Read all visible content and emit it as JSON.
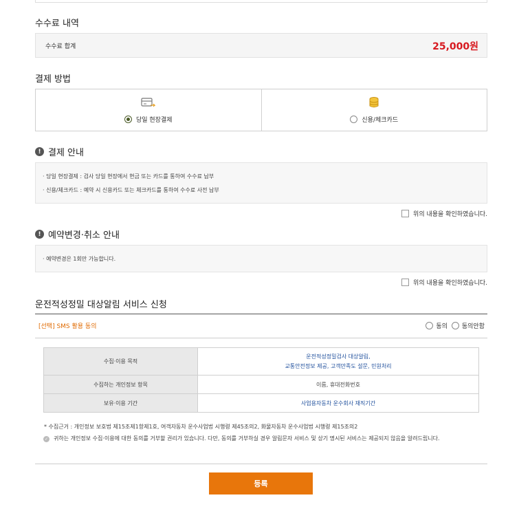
{
  "fee_section": {
    "title": "수수료 내역",
    "total_label": "수수료 합계",
    "total_value": "25,000원"
  },
  "payment_section": {
    "title": "결제 방법",
    "options": [
      {
        "label": "당일 현장결제",
        "icon": "card-icon",
        "selected": true
      },
      {
        "label": "신용/체크카드",
        "icon": "coin-stack-icon",
        "selected": false
      }
    ]
  },
  "payment_notice": {
    "title": "결제 안내",
    "lines": [
      "· 당일 현장결제 : 검사 당일 현장에서 현금 또는 카드를 통하여 수수료 납부",
      "· 신용/체크카드 : 예약 시 신용카드 또는 체크카드를 통하여 수수료 사전 납부"
    ],
    "confirm_label": "위의 내용을 확인하였습니다."
  },
  "change_notice": {
    "title": "예약변경·취소 안내",
    "lines": [
      "· 예약변경은 1회만 가능합니다."
    ],
    "confirm_label": "위의 내용을 확인하였습니다."
  },
  "service_section": {
    "title": "운전적성정밀 대상알림 서비스 신청",
    "sms_label": "[선택] SMS 활용 동의",
    "agree_label": "동의",
    "disagree_label": "동의안함",
    "table": {
      "rows": [
        {
          "header": "수집·이용 목적",
          "value_lines": [
            "운전적성정밀검사 대상알림,",
            "교통안전정보 제공, 고객만족도 설문, 민원처리"
          ]
        },
        {
          "header": "수집하는 개인정보 항목",
          "value_lines": [
            "이름, 휴대전화번호"
          ]
        },
        {
          "header": "보유·이용 기간",
          "value_lines": [
            "사업용자동차 운수회사 재직기간"
          ]
        }
      ]
    },
    "footnote": "* 수집근거 : 개인정보 보호법 제15조제1항제1호, 여객자동차 운수사업법 시행령 제45조의2, 화물자동차 운수사업법 시행령 제15조의2",
    "notice": "귀하는 개인정보 수집·이용에 대한 동의를 거부할 권리가 있습니다. 다만, 동의를 거부하실 경우 알림문자 서비스 및 상기 명시된 서비스는 제공되지 않음을 알려드립니다."
  },
  "submit_label": "등록",
  "colors": {
    "accent": "#e8760b",
    "price": "#d71920",
    "link_blue": "#1f4f9c",
    "sms_orange": "#e06a00"
  }
}
